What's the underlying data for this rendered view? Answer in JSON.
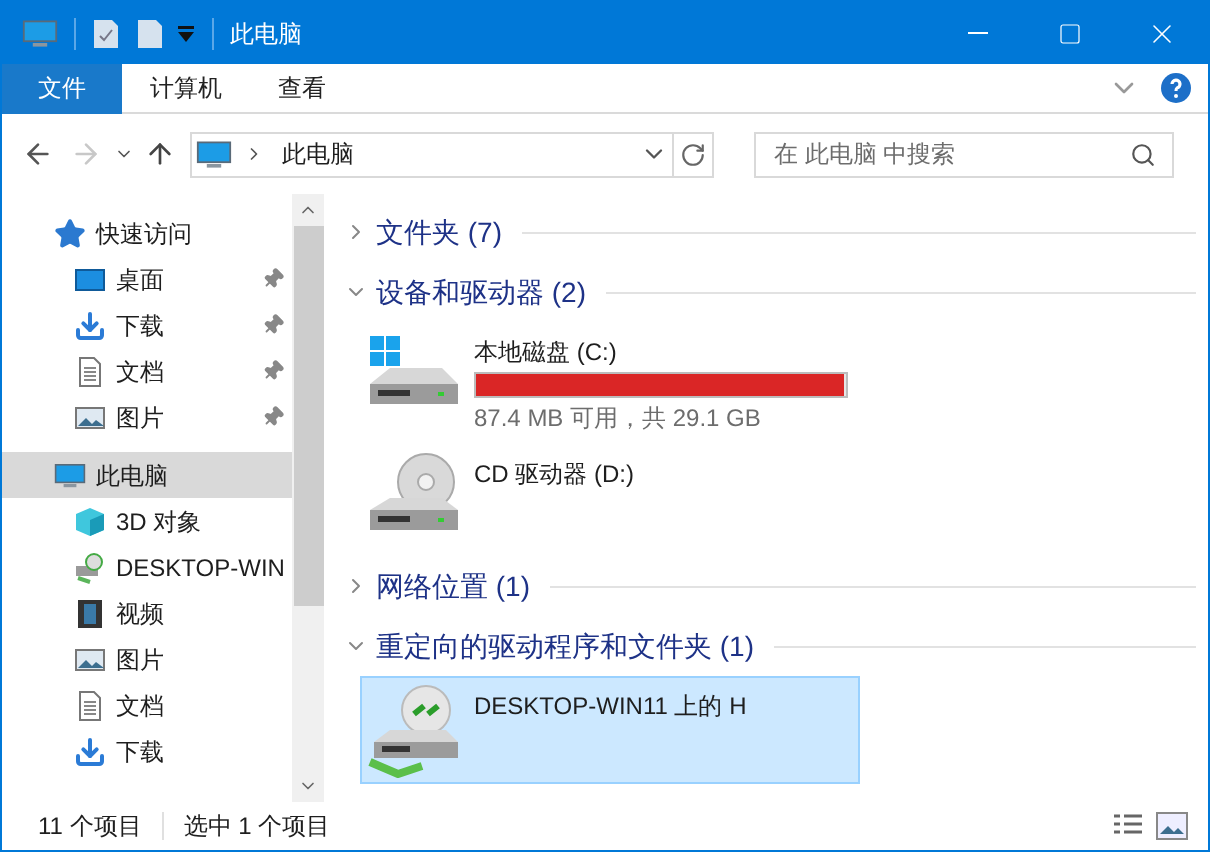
{
  "window": {
    "title": "此电脑"
  },
  "ribbon_tabs": [
    {
      "label": "文件",
      "selected": true
    },
    {
      "label": "计算机",
      "selected": false
    },
    {
      "label": "查看",
      "selected": false
    }
  ],
  "navigation": {
    "forward_disabled": true
  },
  "address": {
    "path": "此电脑"
  },
  "search": {
    "placeholder": "在 此电脑 中搜索"
  },
  "sidebar": {
    "items": [
      {
        "label": "快速访问",
        "kind": "star",
        "selected": false,
        "children": [
          {
            "label": "桌面",
            "kind": "desktop",
            "pinned": true,
            "selected": false
          },
          {
            "label": "下载",
            "kind": "download",
            "pinned": true,
            "selected": false
          },
          {
            "label": "文档",
            "kind": "document",
            "pinned": true,
            "selected": false
          },
          {
            "label": "图片",
            "kind": "picture",
            "pinned": true,
            "selected": false
          }
        ]
      },
      {
        "label": "此电脑",
        "kind": "computer",
        "selected": true,
        "children": [
          {
            "label": "3D 对象",
            "kind": "cube",
            "pinned": false,
            "selected": false
          },
          {
            "label": "DESKTOP-WIN",
            "kind": "network-drive",
            "pinned": false,
            "selected": false
          },
          {
            "label": "视频",
            "kind": "video",
            "pinned": false,
            "selected": false
          },
          {
            "label": "图片",
            "kind": "picture",
            "pinned": false,
            "selected": false
          },
          {
            "label": "文档",
            "kind": "document",
            "pinned": false,
            "selected": false
          },
          {
            "label": "下载",
            "kind": "download",
            "pinned": false,
            "selected": false
          }
        ]
      }
    ]
  },
  "sections": [
    {
      "title": "文件夹 (7)",
      "expanded": false
    },
    {
      "title": "设备和驱动器 (2)",
      "expanded": true,
      "items": [
        {
          "kind": "disk",
          "name": "本地磁盘 (C:)",
          "level": 0.997,
          "detail": "87.4 MB 可用，共 29.1 GB",
          "selected": false
        },
        {
          "kind": "cd",
          "name": "CD 驱动器 (D:)",
          "selected": false
        }
      ]
    },
    {
      "title": "网络位置 (1)",
      "expanded": false
    },
    {
      "title": "重定向的驱动程序和文件夹 (1)",
      "expanded": true,
      "items": [
        {
          "kind": "network-drive",
          "name": "DESKTOP-WIN11 上的 H",
          "selected": true
        }
      ]
    }
  ],
  "status_bar": {
    "item_count": "11 个项目",
    "selection": "选中 1 个项目"
  }
}
